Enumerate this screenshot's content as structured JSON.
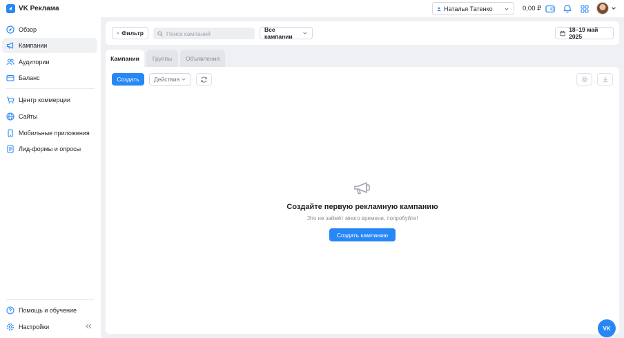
{
  "header": {
    "app_name": "VK Реклама",
    "account_name": "Наталья Татенко",
    "balance": "0,00 ₽"
  },
  "icons": {
    "wallet": "wallet-icon",
    "bell": "bell-icon",
    "apps": "apps-grid-icon",
    "avatar": "user-avatar"
  },
  "sidebar": {
    "items": [
      {
        "label": "Обзор",
        "icon": "compass-icon"
      },
      {
        "label": "Кампании",
        "icon": "megaphone-icon",
        "active": true
      },
      {
        "label": "Аудитории",
        "icon": "users-icon"
      },
      {
        "label": "Баланс",
        "icon": "wallet-icon"
      },
      {
        "label": "Центр коммерции",
        "icon": "cart-icon"
      },
      {
        "label": "Сайты",
        "icon": "globe-icon"
      },
      {
        "label": "Мобильные приложения",
        "icon": "phone-icon"
      },
      {
        "label": "Лид-формы и опросы",
        "icon": "form-icon"
      }
    ],
    "bottom": [
      {
        "label": "Помощь и обучение",
        "icon": "help-icon"
      },
      {
        "label": "Настройки",
        "icon": "gear-icon"
      }
    ]
  },
  "toolbar": {
    "filter_label": "Фильтр",
    "search_placeholder": "Поиск кампаний",
    "campaigns_select": "Все кампании",
    "date_range": "18–19 май 2025"
  },
  "tabs": [
    {
      "label": "Кампании",
      "active": true
    },
    {
      "label": "Группы",
      "active": false
    },
    {
      "label": "Объявления",
      "active": false
    }
  ],
  "actions": {
    "create_label": "Создать",
    "actions_label": "Действия"
  },
  "empty_state": {
    "title": "Создайте первую рекламную кампанию",
    "subtitle": "Это не займёт много времени, попробуйте!",
    "button_label": "Создать кампанию"
  },
  "fab": {
    "label": "VK"
  },
  "colors": {
    "accent": "#2787f5",
    "background": "#eef0f3",
    "panel": "#ffffff"
  }
}
